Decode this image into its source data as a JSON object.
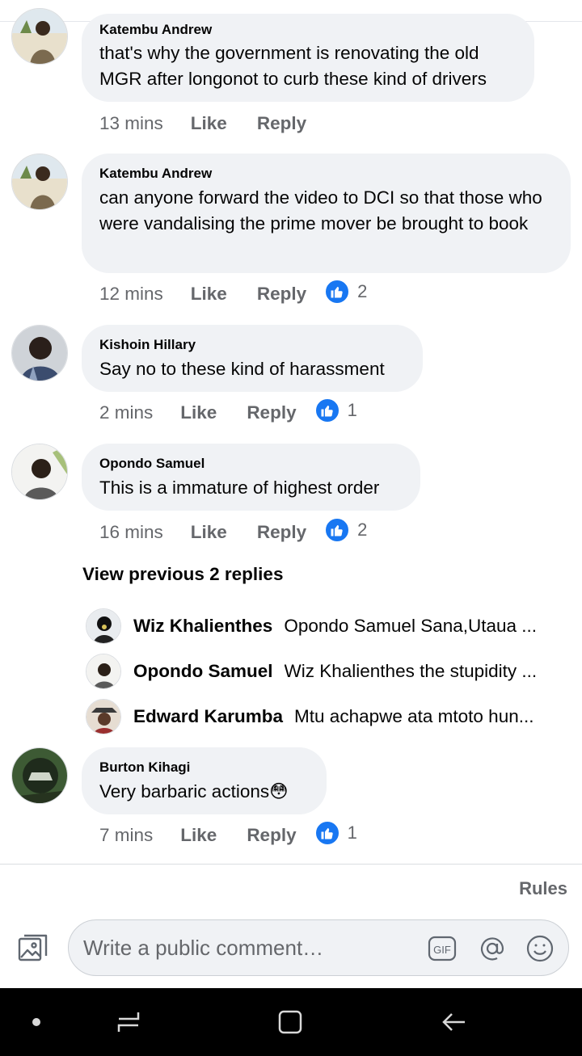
{
  "comments": [
    {
      "author": "Katembu Andrew",
      "text": "that's why the government is renovating the old MGR after longonot to curb these kind of drivers",
      "time": "13 mins",
      "like_label": "Like",
      "reply_label": "Reply",
      "reactions": ""
    },
    {
      "author": "Katembu Andrew",
      "text": "can anyone forward the video to DCI so that those who were vandalising the prime mover be brought to book",
      "time": "12 mins",
      "like_label": "Like",
      "reply_label": "Reply",
      "reactions": "2"
    },
    {
      "author": "Kishoin Hillary",
      "text": "Say no to these kind of harassment",
      "time": "2 mins",
      "like_label": "Like",
      "reply_label": "Reply",
      "reactions": "1"
    },
    {
      "author": "Opondo Samuel",
      "text": "This is a immature of highest order",
      "time": "16 mins",
      "like_label": "Like",
      "reply_label": "Reply",
      "reactions": "2"
    },
    {
      "author": "Burton Kihagi",
      "text": "Very barbaric actions😳",
      "time": "7 mins",
      "like_label": "Like",
      "reply_label": "Reply",
      "reactions": "1"
    }
  ],
  "view_previous": "View previous 2 replies",
  "replies": [
    {
      "name": "Wiz Khalienthes",
      "text": "Opondo Samuel Sana,Utaua ..."
    },
    {
      "name": "Opondo Samuel",
      "text": "Wiz Khalienthes the stupidity ..."
    },
    {
      "name": "Edward Karumba",
      "text": "Mtu achapwe ata mtoto hun..."
    }
  ],
  "rules_label": "Rules",
  "composer": {
    "placeholder": "Write a public comment…"
  },
  "icons": {
    "like_reaction": "thumbs-up-icon",
    "composer_photo": "photo-icon",
    "gif": "gif-icon",
    "mention": "at-icon",
    "emoji": "smiley-icon",
    "nav_dot": "dot-icon",
    "nav_recents": "recent-apps-icon",
    "nav_home": "home-icon",
    "nav_back": "back-icon"
  },
  "colors": {
    "accent": "#1877f2",
    "bubble": "#f0f2f5",
    "secondary_text": "#65676b",
    "navbar": "#000000"
  }
}
